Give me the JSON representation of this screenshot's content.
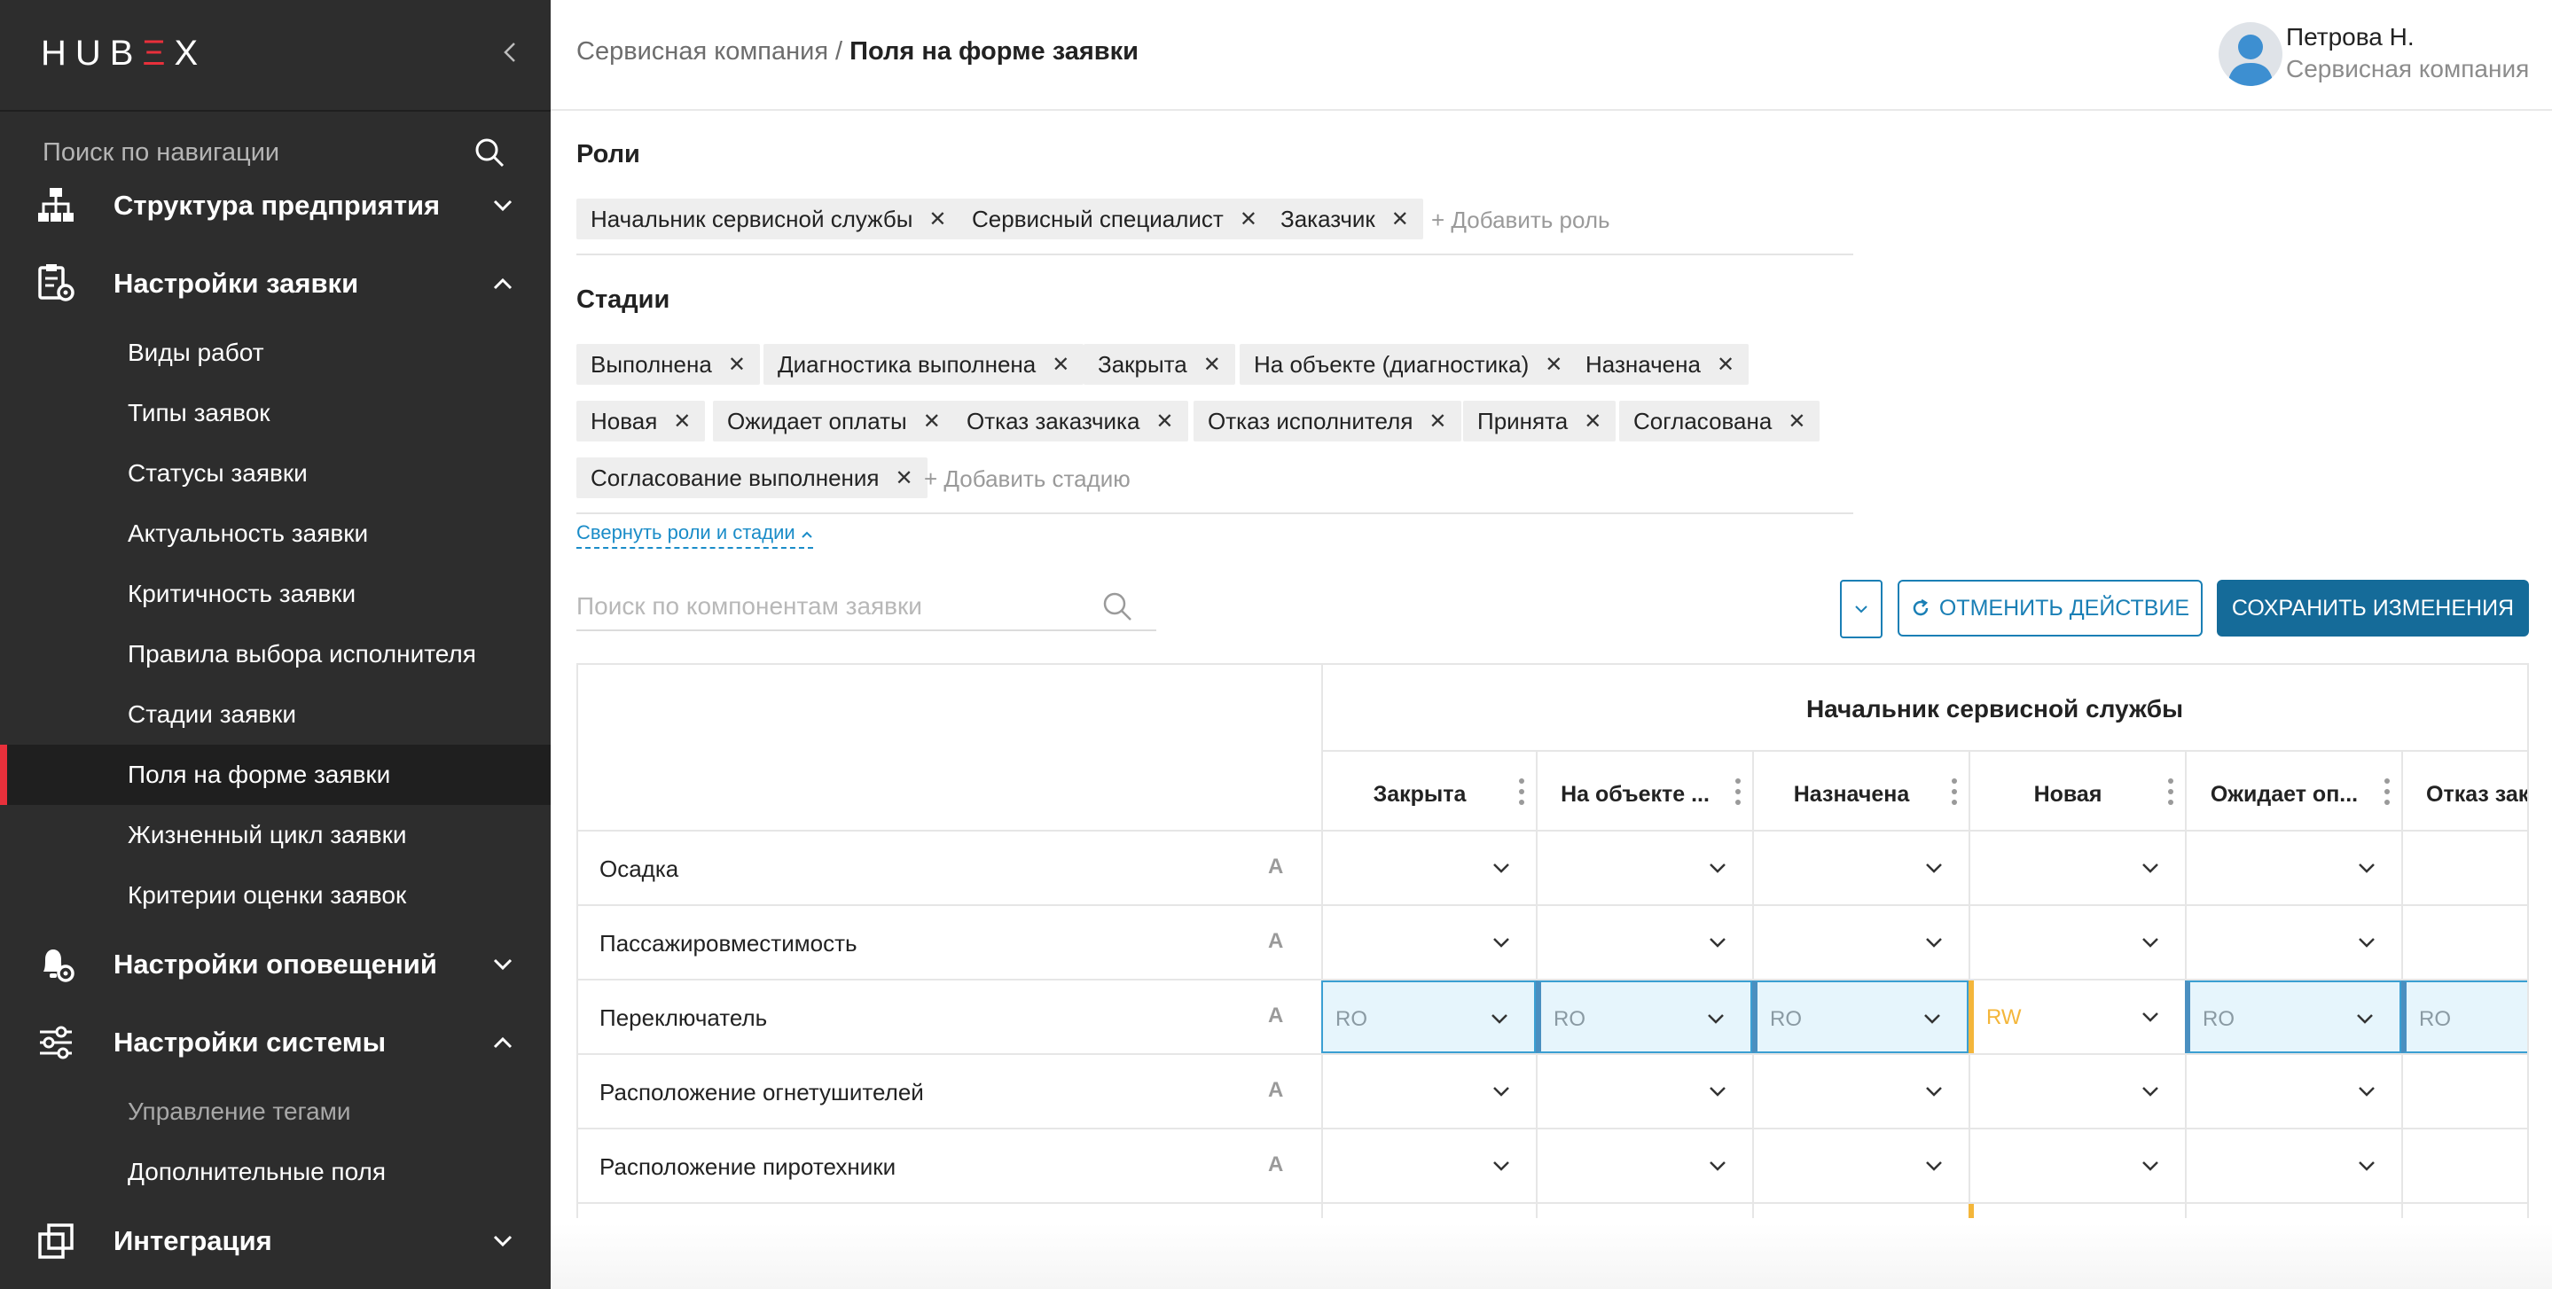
{
  "app": {
    "logo": "HUBEX"
  },
  "sidebar": {
    "search_placeholder": "Поиск по навигации",
    "sections": [
      {
        "label": "Структура предприятия",
        "icon": "org-structure-icon",
        "expanded": false
      },
      {
        "label": "Настройки заявки",
        "icon": "clipboard-settings-icon",
        "expanded": true
      },
      {
        "label": "Настройки оповещений",
        "icon": "bell-settings-icon",
        "expanded": false
      },
      {
        "label": "Настройки системы",
        "icon": "sliders-icon",
        "expanded": true
      },
      {
        "label": "Интеграция",
        "icon": "integration-icon",
        "expanded": false
      }
    ],
    "request_items": [
      "Виды работ",
      "Типы заявок",
      "Статусы заявки",
      "Актуальность заявки",
      "Критичность заявки",
      "Правила выбора исполнителя",
      "Стадии заявки",
      "Поля на форме заявки",
      "Жизненный цикл заявки",
      "Критерии оценки заявок"
    ],
    "active_item": "Поля на форме заявки",
    "system_items": [
      "Управление тегами",
      "Дополнительные поля"
    ]
  },
  "header": {
    "breadcrumb_parent": "Сервисная компания",
    "breadcrumb_sep": "/",
    "breadcrumb_current": "Поля на форме заявки",
    "user_name": "Петрова Н.",
    "user_company": "Сервисная компания"
  },
  "roles": {
    "title": "Роли",
    "chips": [
      "Начальник сервисной службы",
      "Сервисный специалист",
      "Заказчик"
    ],
    "add_label": "+ Добавить роль"
  },
  "stages": {
    "title": "Стадии",
    "chips": [
      "Выполнена",
      "Диагностика выполнена",
      "Закрыта",
      "На объекте (диагностика)",
      "Назначена",
      "Новая",
      "Ожидает оплаты",
      "Отказ заказчика",
      "Отказ исполнителя",
      "Принята",
      "Согласована",
      "Согласование выполнения"
    ],
    "add_label": "+ Добавить стадию",
    "collapse_label": "Свернуть роли и стадии"
  },
  "toolbar": {
    "search_placeholder": "Поиск по компонентам заявки",
    "undo_label": "ОТМЕНИТЬ ДЕЙСТВИЕ",
    "save_label": "СОХРАНИТЬ ИЗМЕНЕНИЯ"
  },
  "colors": {
    "accent": "#e8303b",
    "primary": "#156b99",
    "ro_bg": "#e6f5fc",
    "rw": "#f4b63a"
  },
  "table": {
    "group_title": "Начальник сервисной службы",
    "columns": [
      "Закрыта",
      "На объекте ...",
      "Назначена",
      "Новая",
      "Ожидает оп...",
      "Отказ зак"
    ],
    "rows": [
      {
        "label": "Осадка",
        "type": "A",
        "values": [
          "",
          "",
          "",
          "",
          "",
          ""
        ]
      },
      {
        "label": "Пассажировместимость",
        "type": "A",
        "values": [
          "",
          "",
          "",
          "",
          "",
          ""
        ]
      },
      {
        "label": "Переключатель",
        "type": "A",
        "values": [
          "RO",
          "RO",
          "RO",
          "RW",
          "RO",
          "RO"
        ]
      },
      {
        "label": "Расположение огнетушителей",
        "type": "A",
        "values": [
          "",
          "",
          "",
          "",
          "",
          ""
        ]
      },
      {
        "label": "Расположение пиротехники",
        "type": "A",
        "values": [
          "",
          "",
          "",
          "",
          "",
          ""
        ]
      }
    ]
  }
}
